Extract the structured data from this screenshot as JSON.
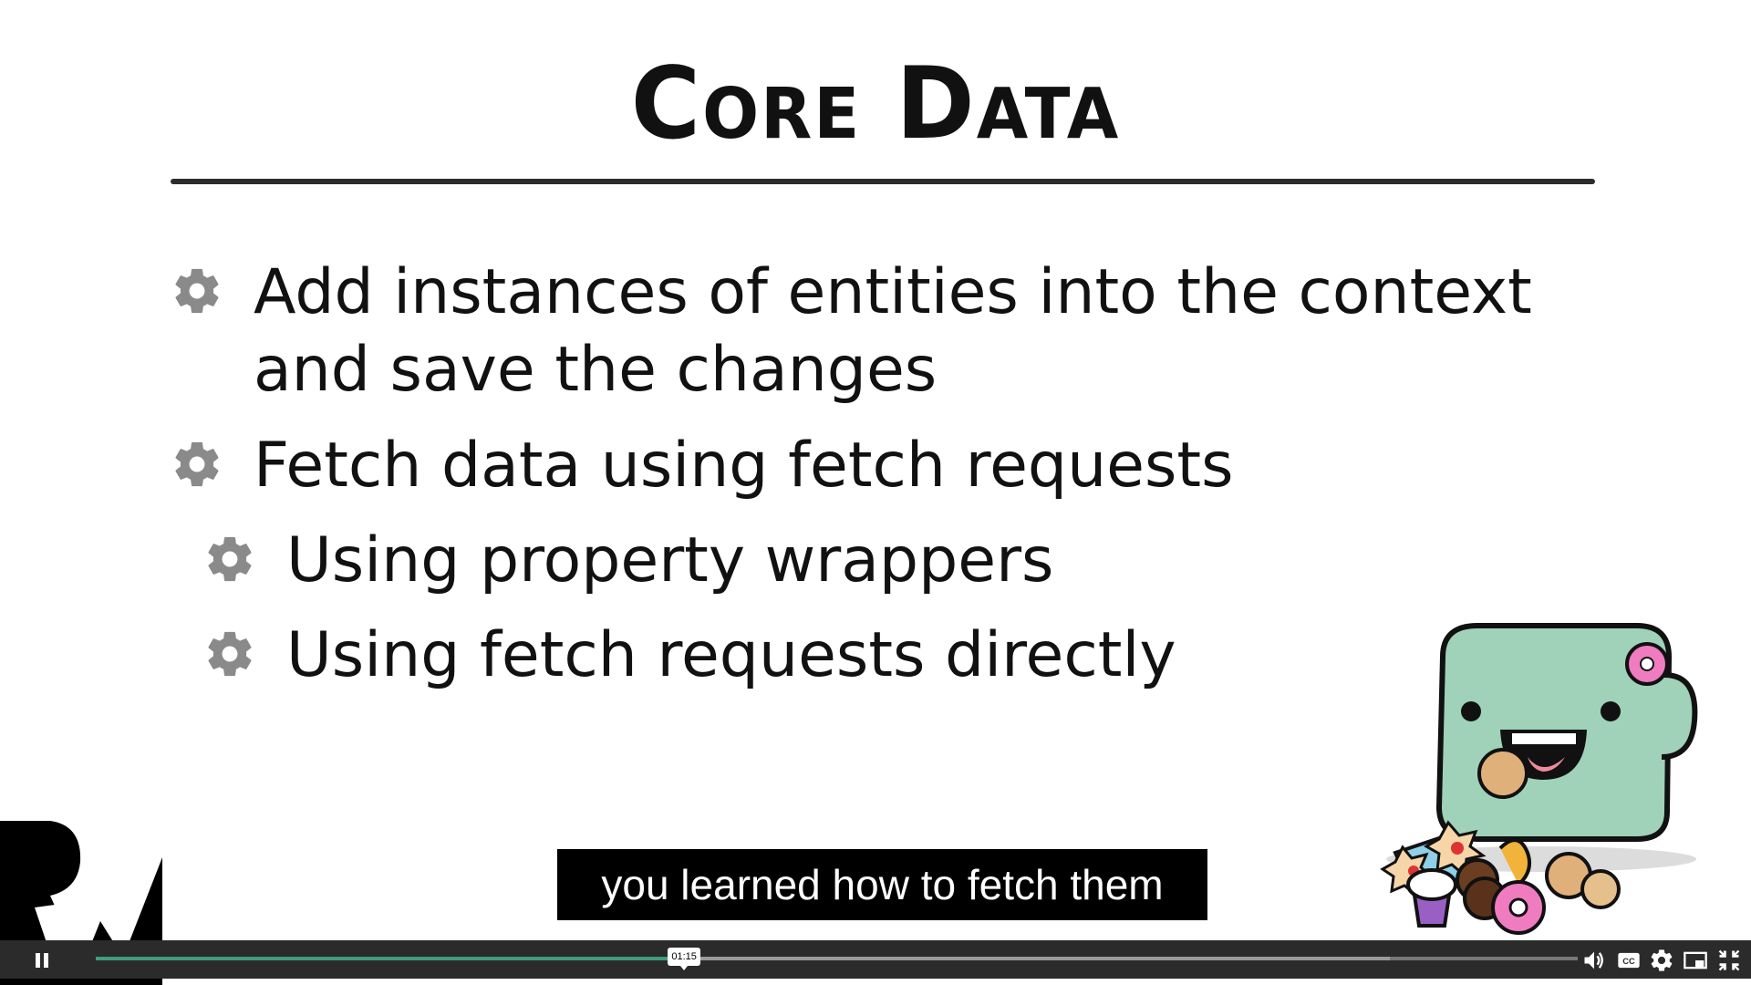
{
  "slide": {
    "title": "Core Data",
    "bullets": [
      "Add instances of entities into the context and save the changes",
      "Fetch data using fetch requests",
      "Using property wrappers",
      "Using fetch requests directly"
    ]
  },
  "caption": "you learned how to fetch them",
  "player": {
    "time_tooltip": "01:15",
    "progress_played_fraction": 0.397,
    "progress_buffered_fraction": 0.873,
    "accent_color": "#3f9d7c",
    "icons": [
      "pause-icon",
      "volume-icon",
      "closed-captions-icon",
      "settings-icon",
      "picture-in-picture-icon",
      "exit-fullscreen-icon"
    ]
  }
}
